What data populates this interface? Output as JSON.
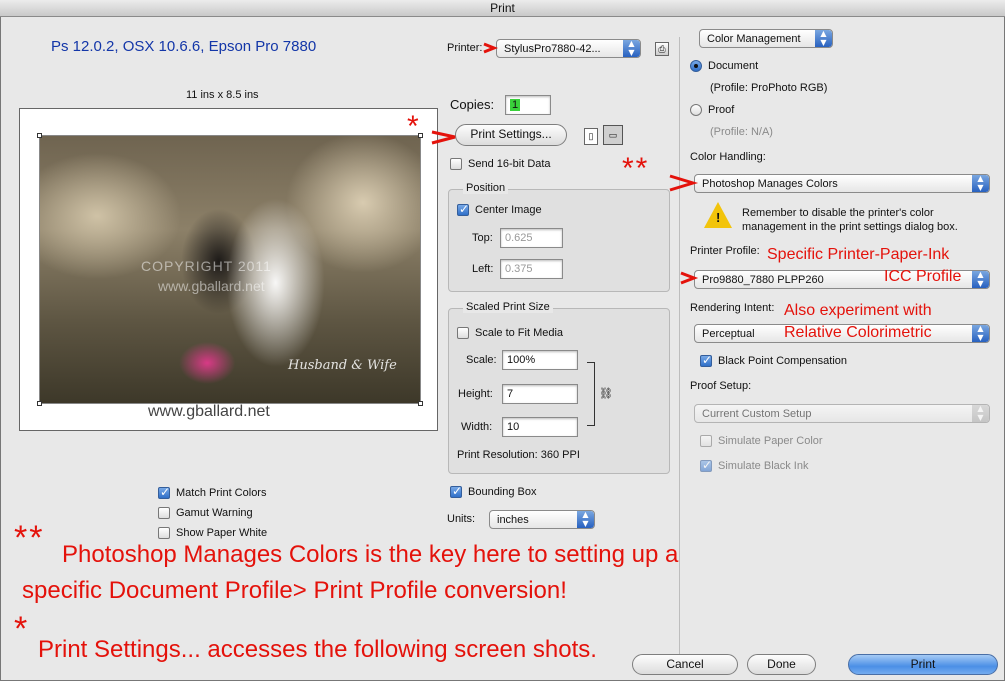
{
  "window": {
    "title": "Print"
  },
  "header": {
    "caption": "Ps 12.0.2, OSX 10.6.6, Epson Pro 7880"
  },
  "preview": {
    "page_size": "11 ins x 8.5 ins",
    "copyright": "COPYRIGHT 2011",
    "copyright_url": "www.gballard.net",
    "signature": "Husband & Wife",
    "caption_url": "www.gballard.net"
  },
  "printer": {
    "label": "Printer:",
    "value": "StylusPro7880-42..."
  },
  "copies": {
    "label": "Copies:",
    "value": "1"
  },
  "print_settings": {
    "label": "Print Settings..."
  },
  "send16bit": {
    "label": "Send 16-bit Data",
    "checked": false
  },
  "position": {
    "title": "Position",
    "center_image": {
      "label": "Center Image",
      "checked": true
    },
    "top": {
      "label": "Top:",
      "value": "0.625"
    },
    "left": {
      "label": "Left:",
      "value": "0.375"
    }
  },
  "scaled": {
    "title": "Scaled Print Size",
    "scale_to_fit": {
      "label": "Scale to Fit Media",
      "checked": false
    },
    "scale": {
      "label": "Scale:",
      "value": "100%"
    },
    "height": {
      "label": "Height:",
      "value": "7"
    },
    "width": {
      "label": "Width:",
      "value": "10"
    },
    "resolution": "Print Resolution: 360 PPI"
  },
  "bounding_box": {
    "label": "Bounding Box",
    "checked": true
  },
  "units": {
    "label": "Units:",
    "value": "inches"
  },
  "match_print_colors": {
    "label": "Match Print Colors",
    "checked": true
  },
  "gamut_warning": {
    "label": "Gamut Warning",
    "checked": false
  },
  "show_paper_white": {
    "label": "Show Paper White",
    "checked": false
  },
  "color_mgmt": {
    "section": "Color Management",
    "document": {
      "label": "Document",
      "profile": "(Profile: ProPhoto RGB)",
      "selected": true
    },
    "proof": {
      "label": "Proof",
      "profile": "(Profile: N/A)",
      "selected": false
    },
    "color_handling_label": "Color Handling:",
    "color_handling_value": "Photoshop Manages Colors",
    "warning": "Remember to disable the printer's color management in the print settings dialog box.",
    "printer_profile_label": "Printer Profile:",
    "printer_profile_value": "Pro9880_7880 PLPP260",
    "rendering_intent_label": "Rendering Intent:",
    "rendering_intent_value": "Perceptual",
    "black_point": {
      "label": "Black Point Compensation",
      "checked": true
    },
    "proof_setup_label": "Proof Setup:",
    "proof_setup_value": "Current Custom Setup",
    "simulate_paper": {
      "label": "Simulate Paper Color",
      "checked": false
    },
    "simulate_black": {
      "label": "Simulate Black Ink",
      "checked": true
    }
  },
  "buttons": {
    "cancel": "Cancel",
    "done": "Done",
    "print": "Print"
  },
  "annotations": {
    "star1": "*",
    "star2": "**",
    "printer_paper_ink": "Specific Printer-Paper-Ink",
    "icc_profile": "ICC Profile",
    "also_experiment": "Also experiment with",
    "relative_colorimetric": "Relative Colorimetric",
    "note_stars": "**",
    "note1_line1": "Photoshop Manages Colors is the key here to setting up a",
    "note1_line2": "specific Document Profile> Print Profile conversion!",
    "note_star": "*",
    "note2": "Print Settings... accesses the following screen shots."
  },
  "colors": {
    "annotation_red": "#e4120b",
    "caption_blue": "#1336a8",
    "accent": "#3a7bd5"
  }
}
